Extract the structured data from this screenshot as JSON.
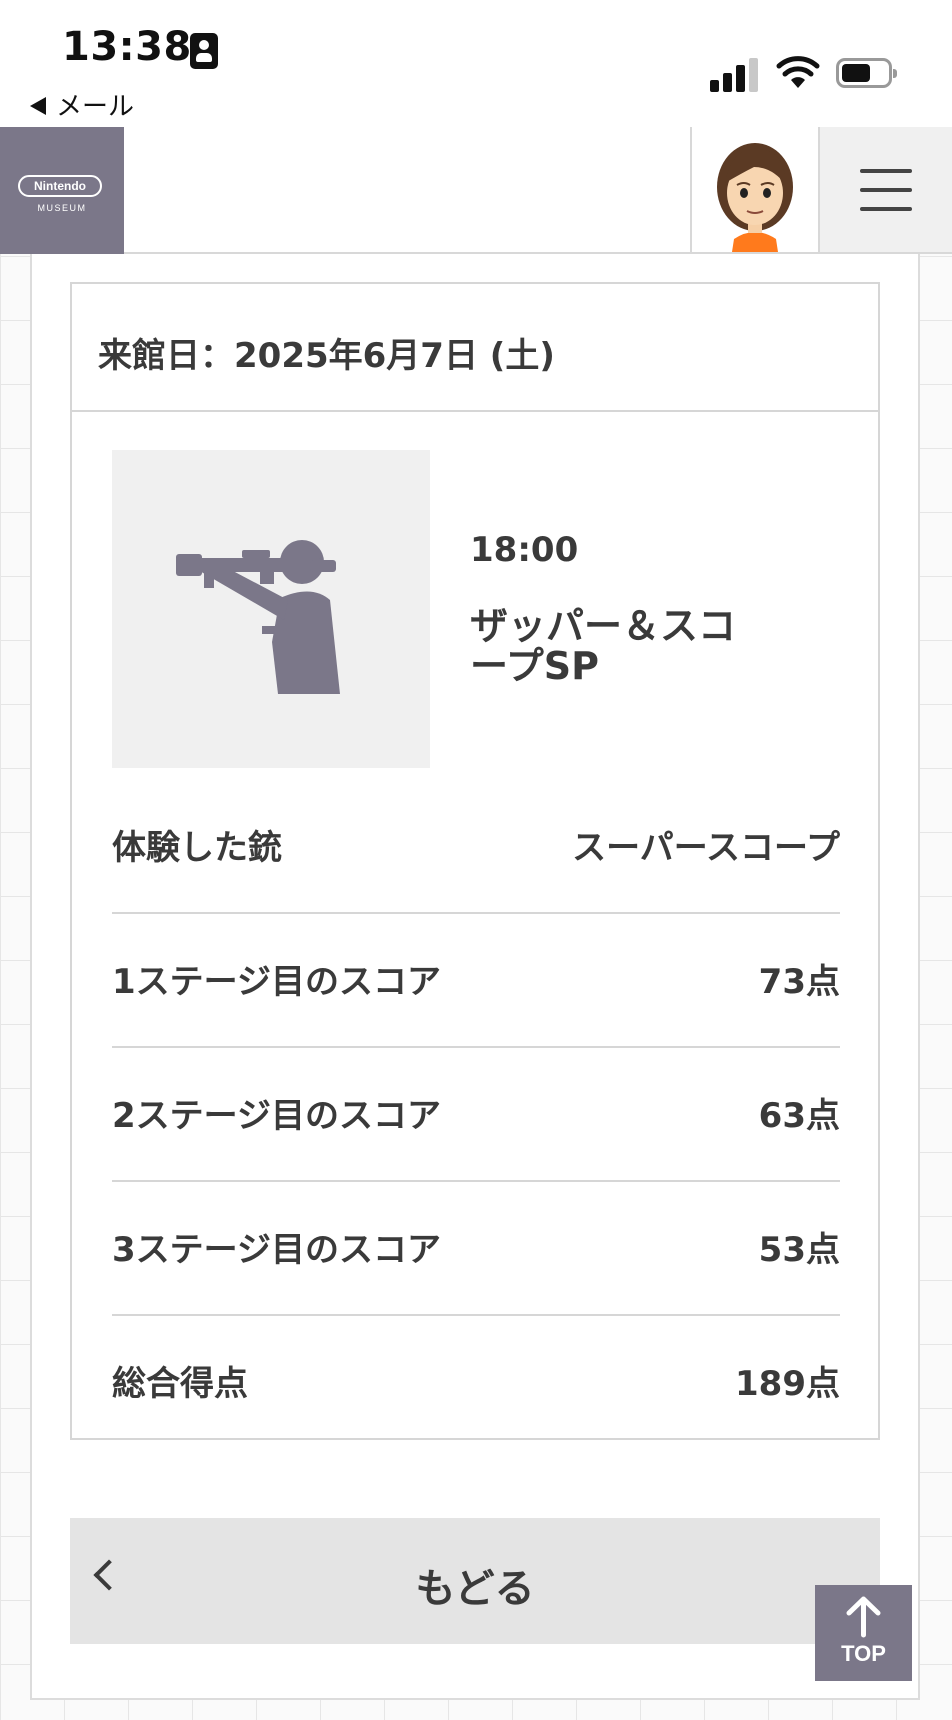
{
  "status_bar": {
    "time": "13:38",
    "back_app": "メール"
  },
  "header": {
    "logo_brand": "Nintendo",
    "logo_sub": "MUSEUM"
  },
  "visit": {
    "date_label": "来館日：2025年6月7日 (土)"
  },
  "experience": {
    "icon": "zapper-scope-icon",
    "time": "18:00",
    "name": "ザッパー＆スコープSP",
    "rows": [
      {
        "label": "体験した銃",
        "value": "スーパースコープ"
      },
      {
        "label": "1ステージ目のスコア",
        "value": "73点"
      },
      {
        "label": "2ステージ目のスコア",
        "value": "63点"
      },
      {
        "label": "3ステージ目のスコア",
        "value": "53点"
      },
      {
        "label": "総合得点",
        "value": "189点"
      }
    ]
  },
  "back_button": {
    "label": "もどる"
  },
  "top_button": {
    "label": "TOP"
  },
  "colors": {
    "brand": "#7b7789",
    "text": "#3a3a3a",
    "divider": "#d6d6d6"
  }
}
